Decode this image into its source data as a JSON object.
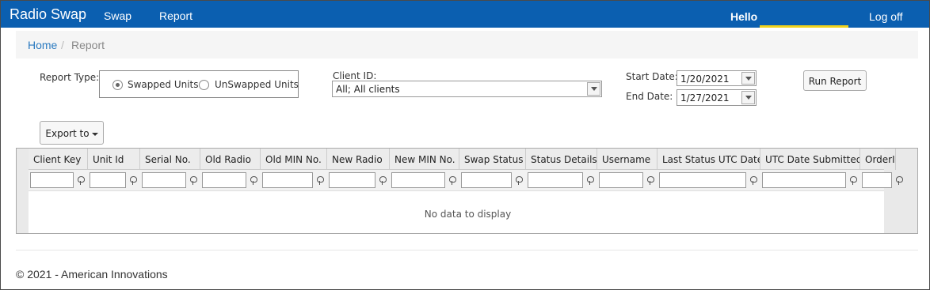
{
  "nav": {
    "brand": "Radio Swap",
    "links": [
      "Swap",
      "Report"
    ],
    "hello": "Hello",
    "logoff": "Log off",
    "bar_color": "#0b5fb0",
    "underline_color": "#f2d31b"
  },
  "breadcrumb": {
    "home": "Home",
    "separator": "/",
    "current": "Report"
  },
  "form": {
    "report_type_label": "Report Type:",
    "options": [
      "Swapped Units",
      "UnSwapped Units"
    ],
    "selected_option": "Swapped Units",
    "client_id_label": "Client ID:",
    "client_id_value": "All; All clients",
    "start_date_label": "Start Date:",
    "start_date": "1/20/2021",
    "end_date_label": "End Date:",
    "end_date": "1/27/2021",
    "run_button": "Run Report",
    "export_button": "Export to"
  },
  "grid": {
    "columns": [
      "Client Key",
      "Unit Id",
      "Serial No.",
      "Old Radio",
      "Old MIN No.",
      "New Radio",
      "New MIN No.",
      "Swap Status",
      "Status Details",
      "Username",
      "Last Status UTC Date",
      "UTC Date Submitted",
      "OrderId"
    ],
    "filter_icon": "funnel-filter-icon",
    "empty_text": "No data to display"
  },
  "footer": {
    "text": "© 2021 - American Innovations"
  }
}
